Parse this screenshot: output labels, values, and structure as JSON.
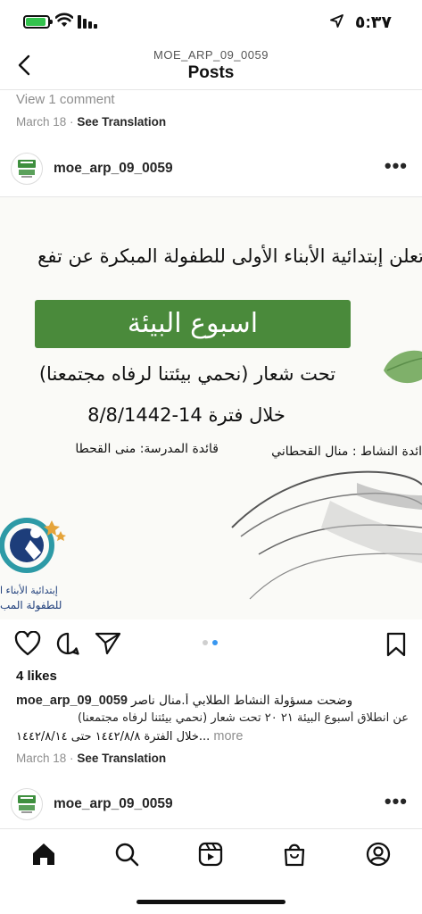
{
  "status_bar": {
    "time": "٥:٣٧",
    "battery_icon": "battery-charging-icon",
    "wifi_icon": "wifi-icon",
    "signal_icon": "cellular-signal-icon",
    "location_icon": "location-arrow-icon"
  },
  "header": {
    "subtitle": "MOE_ARP_09_0059",
    "title": "Posts",
    "back_icon": "chevron-left-icon"
  },
  "previous_post": {
    "view_comments": "View 1 comment",
    "date": "March 18",
    "separator": "·",
    "see_translation": "See Translation"
  },
  "post": {
    "username": "moe_arp_09_0059",
    "more_icon": "more-horizontal-icon",
    "image": {
      "headline": "تعلن إبتدائية الأبناء الأولى للطفولة المبكرة عن تفع",
      "banner": "اسبوع البيئة",
      "slogan": "تحت شعار (نحمي بيئتنا لرفاه مجتمعنا)",
      "period": "خلال فترة  14-8/8/1442",
      "principal": "قائدة المدرسة: منى القحطا",
      "activity_leader": "ائدة النشاط : منال القحطاني",
      "logo_text_1": "إبتدائية الأبناء ا",
      "logo_text_2": "للطفولة المب"
    },
    "carousel": {
      "count": 2,
      "active_index": 1
    },
    "likes": "4 likes",
    "caption_username": "moe_arp_09_0059",
    "caption_line1": "وضحت مسؤولة النشاط الطلابي أ.منال ناصر",
    "caption_line2": "عن انطلاق أسبوع البيئة ٢١ ٢٠ تحت شعار (نحمي بيئتنا لرفاه مجتمعنا)",
    "caption_line3": "خلال الفترة ١٤٤٢/٨/٨ حتى ١٤٤٢/٨/١٤...",
    "more_label": "more",
    "date": "March 18",
    "separator": "·",
    "see_translation": "See Translation"
  },
  "next_post": {
    "username": "moe_arp_09_0059"
  },
  "bottom_nav": {
    "items": [
      "home-icon",
      "search-icon",
      "reels-icon",
      "shop-icon",
      "profile-icon"
    ],
    "active": "home-icon"
  },
  "colors": {
    "accent_blue": "#3897f0",
    "banner_green": "#4a8a3b",
    "battery_green": "#33c24d",
    "muted_text": "#8e8e8e"
  }
}
